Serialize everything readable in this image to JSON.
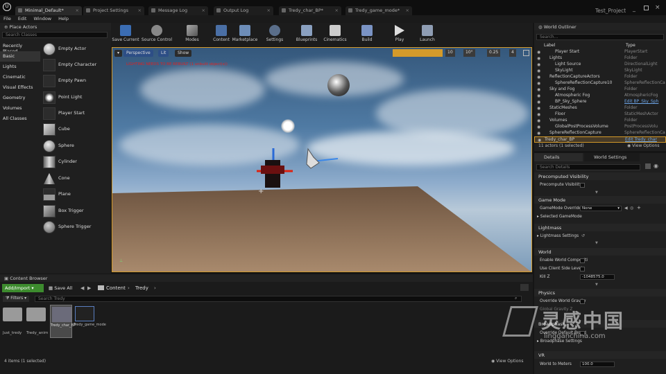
{
  "tabs": [
    {
      "label": "Minimal_Default*"
    },
    {
      "label": "Project Settings"
    },
    {
      "label": "Message Log"
    },
    {
      "label": "Output Log"
    },
    {
      "label": "Tredy_char_BP*"
    },
    {
      "label": "Tredy_game_mode*"
    }
  ],
  "project_name": "Test_Project",
  "menu": [
    "File",
    "Edit",
    "Window",
    "Help"
  ],
  "place_actors": {
    "title": "Place Actors",
    "search_placeholder": "Search Classes",
    "categories": [
      "Recently Placed",
      "Basic",
      "Lights",
      "Cinematic",
      "Visual Effects",
      "Geometry",
      "Volumes",
      "All Classes"
    ],
    "items": [
      "Empty Actor",
      "Empty Character",
      "Empty Pawn",
      "Point Light",
      "Player Start",
      "Cube",
      "Sphere",
      "Cylinder",
      "Cone",
      "Plane",
      "Box Trigger",
      "Sphere Trigger"
    ]
  },
  "toolbar": {
    "buttons": [
      "Save Current",
      "Source Control",
      "Modes",
      "Content",
      "Marketplace",
      "Settings",
      "Blueprints",
      "Cinematics",
      "Build",
      "Play",
      "Launch"
    ]
  },
  "viewport": {
    "perspective": "Perspective",
    "lit": "Lit",
    "show": "Show",
    "warning": "LIGHTING NEEDS TO BE REBUILT (1 unbuilt object(s))",
    "grid": "10",
    "angle": "10°",
    "scale": "0.25",
    "camera_speed": "4"
  },
  "content_browser": {
    "title": "Content Browser",
    "add_import": "Add/Import",
    "save_all": "Save All",
    "path_content": "Content",
    "path_folder": "Tredy",
    "filters": "Filters",
    "search_placeholder": "Search Tredy",
    "assets": [
      {
        "label": "Just_tredy"
      },
      {
        "label": "Tredy_anim"
      },
      {
        "label": "Tredy_char_BP"
      },
      {
        "label": "Tredy_game_mode"
      }
    ],
    "status": "4 items (1 selected)",
    "view_options": "View Options"
  },
  "world_outliner": {
    "title": "World Outliner",
    "search_placeholder": "Search...",
    "col_label": "Label",
    "col_type": "Type",
    "rows": [
      {
        "name": "Player Start",
        "type": "PlayerStart"
      },
      {
        "name": "Lights",
        "type": "Folder"
      },
      {
        "name": "Light Source",
        "type": "DirectionalLight"
      },
      {
        "name": "SkyLight",
        "type": "SkyLight"
      },
      {
        "name": "ReflectionCaptureActors",
        "type": "Folder"
      },
      {
        "name": "SphereReflectionCapture10",
        "type": "SphereReflectionCa"
      },
      {
        "name": "Sky and Fog",
        "type": "Folder"
      },
      {
        "name": "Atmospheric Fog",
        "type": "AtmosphericFog"
      },
      {
        "name": "BP_Sky_Sphere",
        "type": "Edit BP_Sky_Sph"
      },
      {
        "name": "StaticMeshes",
        "type": "Folder"
      },
      {
        "name": "Floor",
        "type": "StaticMeshActor"
      },
      {
        "name": "Volumes",
        "type": "Folder"
      },
      {
        "name": "GlobalPostProcessVolume",
        "type": "PostProcessVolu"
      },
      {
        "name": "SphereReflectionCapture",
        "type": "SphereReflectionCa"
      },
      {
        "name": "Tredy_char_BP",
        "type": "Edit Tredy_char"
      }
    ],
    "status": "11 actors (1 selected)",
    "view_options": "View Options"
  },
  "details": {
    "tab_details": "Details",
    "tab_world_settings": "World Settings",
    "search_placeholder": "Search Details",
    "sections": {
      "precomputed_visibility": "Precomputed Visibility",
      "game_mode": "Game Mode",
      "lightmass": "Lightmass",
      "world": "World",
      "physics": "Physics",
      "broadphase": "Broadphase",
      "vr": "VR"
    },
    "props": {
      "precompute_visibility": "Precompute Visibility",
      "gamemode_override": "GameMode Override",
      "gamemode_value": "None",
      "selected_gamemode": "Selected GameMode",
      "lightmass_settings": "Lightmass Settings",
      "enable_world_composition": "Enable World Compositi",
      "use_client_side_level": "Use Client Side Level",
      "kill_z": "Kill Z",
      "kill_z_value": "-1048575.0",
      "override_world_gravity": "Override World Gravity",
      "global_gravity": "Global Gravity Z",
      "override_default_broad": "Override Default Broad",
      "broadphase_settings": "Broadphase Settings",
      "world_to_meters": "World to Meters",
      "world_to_meters_value": "100.0"
    }
  },
  "watermark": {
    "text": "灵感中国",
    "url": "lingganchina.com"
  }
}
